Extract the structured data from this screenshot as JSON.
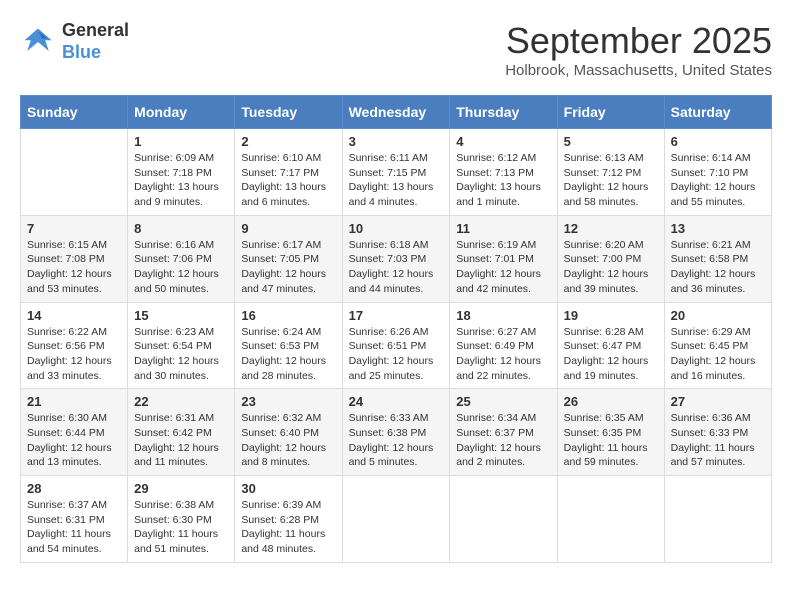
{
  "logo": {
    "line1": "General",
    "line2": "Blue"
  },
  "title": "September 2025",
  "location": "Holbrook, Massachusetts, United States",
  "weekdays": [
    "Sunday",
    "Monday",
    "Tuesday",
    "Wednesday",
    "Thursday",
    "Friday",
    "Saturday"
  ],
  "weeks": [
    [
      {
        "day": "",
        "info": ""
      },
      {
        "day": "1",
        "info": "Sunrise: 6:09 AM\nSunset: 7:18 PM\nDaylight: 13 hours\nand 9 minutes."
      },
      {
        "day": "2",
        "info": "Sunrise: 6:10 AM\nSunset: 7:17 PM\nDaylight: 13 hours\nand 6 minutes."
      },
      {
        "day": "3",
        "info": "Sunrise: 6:11 AM\nSunset: 7:15 PM\nDaylight: 13 hours\nand 4 minutes."
      },
      {
        "day": "4",
        "info": "Sunrise: 6:12 AM\nSunset: 7:13 PM\nDaylight: 13 hours\nand 1 minute."
      },
      {
        "day": "5",
        "info": "Sunrise: 6:13 AM\nSunset: 7:12 PM\nDaylight: 12 hours\nand 58 minutes."
      },
      {
        "day": "6",
        "info": "Sunrise: 6:14 AM\nSunset: 7:10 PM\nDaylight: 12 hours\nand 55 minutes."
      }
    ],
    [
      {
        "day": "7",
        "info": "Sunrise: 6:15 AM\nSunset: 7:08 PM\nDaylight: 12 hours\nand 53 minutes."
      },
      {
        "day": "8",
        "info": "Sunrise: 6:16 AM\nSunset: 7:06 PM\nDaylight: 12 hours\nand 50 minutes."
      },
      {
        "day": "9",
        "info": "Sunrise: 6:17 AM\nSunset: 7:05 PM\nDaylight: 12 hours\nand 47 minutes."
      },
      {
        "day": "10",
        "info": "Sunrise: 6:18 AM\nSunset: 7:03 PM\nDaylight: 12 hours\nand 44 minutes."
      },
      {
        "day": "11",
        "info": "Sunrise: 6:19 AM\nSunset: 7:01 PM\nDaylight: 12 hours\nand 42 minutes."
      },
      {
        "day": "12",
        "info": "Sunrise: 6:20 AM\nSunset: 7:00 PM\nDaylight: 12 hours\nand 39 minutes."
      },
      {
        "day": "13",
        "info": "Sunrise: 6:21 AM\nSunset: 6:58 PM\nDaylight: 12 hours\nand 36 minutes."
      }
    ],
    [
      {
        "day": "14",
        "info": "Sunrise: 6:22 AM\nSunset: 6:56 PM\nDaylight: 12 hours\nand 33 minutes."
      },
      {
        "day": "15",
        "info": "Sunrise: 6:23 AM\nSunset: 6:54 PM\nDaylight: 12 hours\nand 30 minutes."
      },
      {
        "day": "16",
        "info": "Sunrise: 6:24 AM\nSunset: 6:53 PM\nDaylight: 12 hours\nand 28 minutes."
      },
      {
        "day": "17",
        "info": "Sunrise: 6:26 AM\nSunset: 6:51 PM\nDaylight: 12 hours\nand 25 minutes."
      },
      {
        "day": "18",
        "info": "Sunrise: 6:27 AM\nSunset: 6:49 PM\nDaylight: 12 hours\nand 22 minutes."
      },
      {
        "day": "19",
        "info": "Sunrise: 6:28 AM\nSunset: 6:47 PM\nDaylight: 12 hours\nand 19 minutes."
      },
      {
        "day": "20",
        "info": "Sunrise: 6:29 AM\nSunset: 6:45 PM\nDaylight: 12 hours\nand 16 minutes."
      }
    ],
    [
      {
        "day": "21",
        "info": "Sunrise: 6:30 AM\nSunset: 6:44 PM\nDaylight: 12 hours\nand 13 minutes."
      },
      {
        "day": "22",
        "info": "Sunrise: 6:31 AM\nSunset: 6:42 PM\nDaylight: 12 hours\nand 11 minutes."
      },
      {
        "day": "23",
        "info": "Sunrise: 6:32 AM\nSunset: 6:40 PM\nDaylight: 12 hours\nand 8 minutes."
      },
      {
        "day": "24",
        "info": "Sunrise: 6:33 AM\nSunset: 6:38 PM\nDaylight: 12 hours\nand 5 minutes."
      },
      {
        "day": "25",
        "info": "Sunrise: 6:34 AM\nSunset: 6:37 PM\nDaylight: 12 hours\nand 2 minutes."
      },
      {
        "day": "26",
        "info": "Sunrise: 6:35 AM\nSunset: 6:35 PM\nDaylight: 11 hours\nand 59 minutes."
      },
      {
        "day": "27",
        "info": "Sunrise: 6:36 AM\nSunset: 6:33 PM\nDaylight: 11 hours\nand 57 minutes."
      }
    ],
    [
      {
        "day": "28",
        "info": "Sunrise: 6:37 AM\nSunset: 6:31 PM\nDaylight: 11 hours\nand 54 minutes."
      },
      {
        "day": "29",
        "info": "Sunrise: 6:38 AM\nSunset: 6:30 PM\nDaylight: 11 hours\nand 51 minutes."
      },
      {
        "day": "30",
        "info": "Sunrise: 6:39 AM\nSunset: 6:28 PM\nDaylight: 11 hours\nand 48 minutes."
      },
      {
        "day": "",
        "info": ""
      },
      {
        "day": "",
        "info": ""
      },
      {
        "day": "",
        "info": ""
      },
      {
        "day": "",
        "info": ""
      }
    ]
  ]
}
